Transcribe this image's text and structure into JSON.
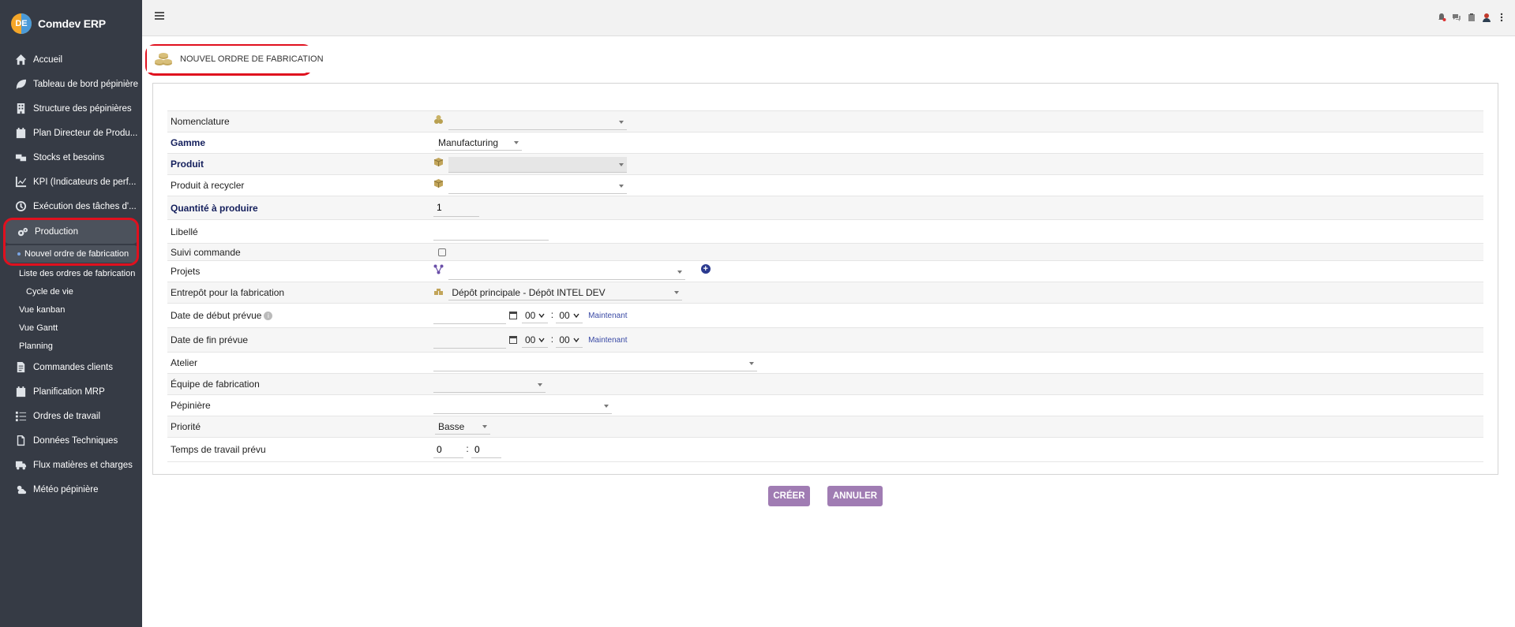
{
  "brand": {
    "title": "Comdev ERP",
    "logo_letter": "DE"
  },
  "sidebar": {
    "items": [
      {
        "label": "Accueil",
        "icon": "home-icon"
      },
      {
        "label": "Tableau de bord pépinière",
        "icon": "leaf-icon"
      },
      {
        "label": "Structure des pépinières",
        "icon": "building-icon"
      },
      {
        "label": "Plan Directeur de Produ...",
        "icon": "calendar-icon"
      },
      {
        "label": "Stocks et besoins",
        "icon": "boxes-icon"
      },
      {
        "label": "KPI (Indicateurs de perf...",
        "icon": "chart-line-icon"
      },
      {
        "label": "Exécution des tâches d'...",
        "icon": "clock-icon"
      },
      {
        "label": "Production",
        "icon": "gears-icon"
      }
    ],
    "production_sub": [
      {
        "label": "Nouvel ordre de fabrication"
      },
      {
        "label": "Liste des ordres de fabrication"
      },
      {
        "label": "Cycle de vie"
      },
      {
        "label": "Vue kanban"
      },
      {
        "label": "Vue Gantt"
      },
      {
        "label": "Planning"
      }
    ],
    "items_after": [
      {
        "label": "Commandes clients",
        "icon": "file-icon"
      },
      {
        "label": "Planification MRP",
        "icon": "calendar-icon"
      },
      {
        "label": "Ordres de travail",
        "icon": "list-check-icon"
      },
      {
        "label": "Données Techniques",
        "icon": "document-icon"
      },
      {
        "label": "Flux matières et charges",
        "icon": "truck-icon"
      },
      {
        "label": "Météo pépinière",
        "icon": "cloud-sun-icon"
      }
    ]
  },
  "page": {
    "title": "Nouvel ordre de fabrication"
  },
  "form": {
    "nomenclature": {
      "label": "Nomenclature",
      "value": ""
    },
    "gamme": {
      "label": "Gamme",
      "value": "Manufacturing"
    },
    "produit": {
      "label": "Produit",
      "value": ""
    },
    "produit_recycler": {
      "label": "Produit à recycler",
      "value": ""
    },
    "quantite": {
      "label": "Quantité à produire",
      "value": "1"
    },
    "libelle": {
      "label": "Libellé",
      "value": ""
    },
    "suivi_commande": {
      "label": "Suivi commande",
      "checked": false
    },
    "projets": {
      "label": "Projets",
      "value": ""
    },
    "entrepot": {
      "label": "Entrepôt pour la fabrication",
      "value": "Dépôt principale - Dépôt INTEL DEV"
    },
    "date_debut": {
      "label": "Date de début prévue",
      "date": "",
      "hour": "00",
      "minute": "00",
      "now_label": "Maintenant"
    },
    "date_fin": {
      "label": "Date de fin prévue",
      "date": "",
      "hour": "00",
      "minute": "00",
      "now_label": "Maintenant"
    },
    "atelier": {
      "label": "Atelier",
      "value": ""
    },
    "equipe": {
      "label": "Équipe de fabrication",
      "value": ""
    },
    "pepiniere": {
      "label": "Pépinière",
      "value": ""
    },
    "priorite": {
      "label": "Priorité",
      "value": "Basse"
    },
    "temps": {
      "label": "Temps de travail prévu",
      "hours": "0",
      "minutes": "0",
      "separator": ":"
    }
  },
  "buttons": {
    "create": "Créer",
    "cancel": "Annuler"
  },
  "colors": {
    "sidebar_bg": "#363b45",
    "button_bg": "#a07cb3",
    "required_label": "#141f5c",
    "highlight": "#e0101e"
  }
}
